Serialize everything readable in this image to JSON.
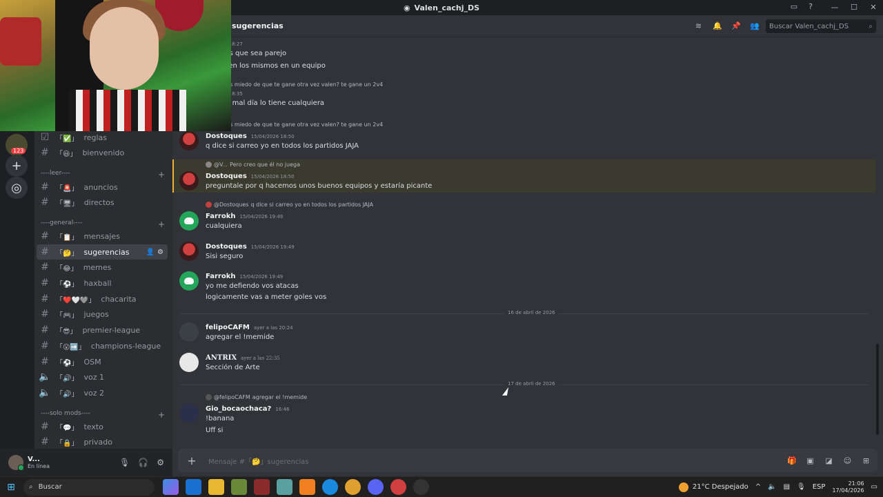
{
  "window": {
    "title": "Valen_cachj_DS"
  },
  "guilds": {
    "badge": "123"
  },
  "channel_header": {
    "title": "sugerencias",
    "search_placeholder": "Buscar Valen_cachj_DS"
  },
  "sidebar": {
    "channels_top": [
      {
        "emoji": "「✅」",
        "name": "reglas"
      },
      {
        "emoji": "「😃」",
        "name": "bienvenido"
      }
    ],
    "cat_leer": "----leer----",
    "channels_leer": [
      {
        "emoji": "「🚨」",
        "name": "anuncios"
      },
      {
        "emoji": "「🖥」",
        "name": "directos"
      }
    ],
    "cat_general": "----general----",
    "channels_general": [
      {
        "emoji": "「📋」",
        "name": "mensajes"
      },
      {
        "emoji": "「🤔」",
        "name": "sugerencias"
      },
      {
        "emoji": "「😂」",
        "name": "memes"
      },
      {
        "emoji": "「⚽」",
        "name": "haxball"
      },
      {
        "emoji": "「❤️🤍🩶」",
        "name": "chacarita"
      },
      {
        "emoji": "「🎮」",
        "name": "juegos"
      },
      {
        "emoji": "「😎」",
        "name": "premier-league"
      },
      {
        "emoji": "「😮➡️」",
        "name": "champions-league"
      },
      {
        "emoji": "「⚽」",
        "name": "OSM"
      },
      {
        "emoji": "「🔊」",
        "name": "voz 1"
      },
      {
        "emoji": "「🔊」",
        "name": "voz 2"
      }
    ],
    "cat_mods": "----solo mods----",
    "channels_mods": [
      {
        "emoji": "「💬」",
        "name": "texto"
      },
      {
        "emoji": "「🔒」",
        "name": "privado"
      }
    ]
  },
  "user": {
    "name": "V...",
    "status": "En línea"
  },
  "messages_partial": [
    {
      "ts": "/04/2026 18:27",
      "lines": [
        "ugamos que sea parejo",
        "se ponen los mismos en un equipo"
      ]
    },
    {
      "reply": "okh tenes miedo de que te gane otra vez valen? te gane un 2v4",
      "ts": "/04/2026 18:35",
      "lines": [
        "SJSJ Un mal día lo tiene cualquiera"
      ]
    },
    {
      "reply": "okh tenes miedo de que te gane otra vez valen? te gane un 2v4"
    }
  ],
  "messages": [
    {
      "author": "Dostoques",
      "ts": "15/04/2026 18:50",
      "lines": [
        "q dice si carreo yo en todos los partidos JAJA"
      ]
    },
    {
      "reply_user": "@V...",
      "reply_text": "Pero creo que él no juega",
      "author": "Dostoques",
      "ts": "15/04/2026 18:50",
      "lines": [
        "preguntale por q hacemos unos buenos equipos y estaría picante"
      ]
    },
    {
      "reply_user": "@Dostoques",
      "reply_text": "q dice si carreo yo en todos los partidos JAJA",
      "author": "Farrokh",
      "ts": "15/04/2026 19:49",
      "lines": [
        "cualquiera"
      ]
    },
    {
      "author": "Dostoques",
      "ts": "15/04/2026 19:49",
      "lines": [
        "Sisi seguro"
      ]
    },
    {
      "author": "Farrokh",
      "ts": "15/04/2026 19:49",
      "lines": [
        "yo me defiendo vos atacas",
        "logicamente vas a meter goles vos"
      ]
    },
    {
      "author": "felipoCAFM",
      "ts": "ayer a las 20:24",
      "lines": [
        "agregar el !memide"
      ]
    },
    {
      "author": "ANTRIX",
      "ts": "ayer a las 22:35",
      "lines": [
        "Sección de Arte"
      ]
    },
    {
      "reply_user": "@felipoCAFM",
      "reply_text": "agregar el !memide",
      "author": "Gio_bocaochaca?",
      "ts": "16:46",
      "lines": [
        "!banana",
        "Uff si"
      ]
    }
  ],
  "dividers": [
    "16 de abril de 2026",
    "17 de abril de 2026"
  ],
  "composer": {
    "placeholder": "Mensaje #「🤔」sugerencias"
  },
  "taskbar": {
    "search": "Buscar",
    "weather": "21°C  Despejado",
    "lang": "ESP",
    "time": "21:06",
    "date": "17/04/2026"
  }
}
